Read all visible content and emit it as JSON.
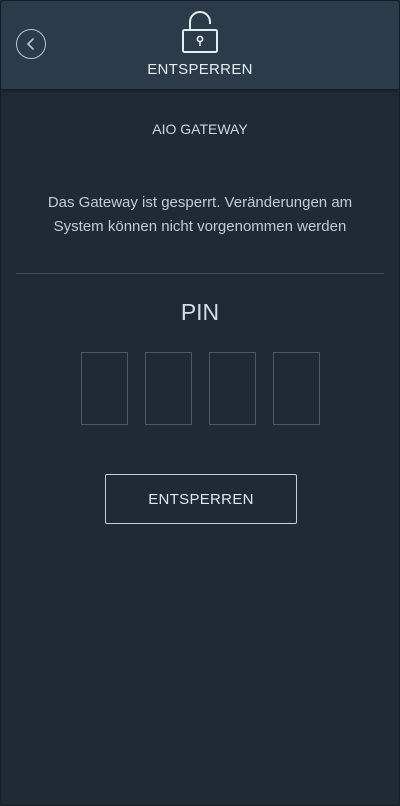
{
  "header": {
    "title": "ENTSPERREN",
    "back_icon": "chevron-left-icon",
    "lock_icon": "unlocked-padlock-icon"
  },
  "device": {
    "name": "AIO GATEWAY"
  },
  "message": "Das Gateway ist gesperrt. Veränderungen am System können nicht vorgenommen werden",
  "pin": {
    "label": "PIN",
    "digits": [
      "",
      "",
      "",
      ""
    ]
  },
  "unlock_button": {
    "label": "ENTSPERREN"
  },
  "colors": {
    "background": "#1f2a35",
    "header": "#2c3b4a",
    "text": "#d7e3ec",
    "border": "#4a5966"
  }
}
